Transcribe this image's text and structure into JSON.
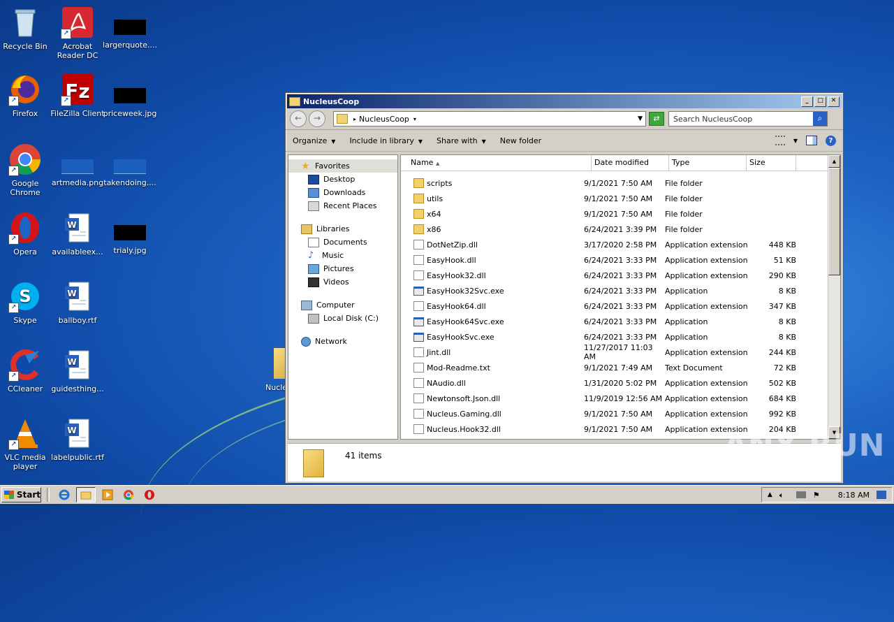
{
  "desktop": {
    "icons": [
      {
        "label": "Recycle Bin",
        "icon": "recycle-bin-icon"
      },
      {
        "label": "Acrobat Reader DC",
        "icon": "acrobat-icon"
      },
      {
        "label": "largerquote....",
        "icon": "image-thumbnail-icon"
      },
      {
        "label": "Firefox",
        "icon": "firefox-icon"
      },
      {
        "label": "FileZilla Client",
        "icon": "filezilla-icon"
      },
      {
        "label": "priceweek.jpg",
        "icon": "image-thumbnail-icon"
      },
      {
        "label": "Google Chrome",
        "icon": "chrome-icon"
      },
      {
        "label": "artmedia.png",
        "icon": "image-thumbnail-icon"
      },
      {
        "label": "takendoing....",
        "icon": "image-thumbnail-icon"
      },
      {
        "label": "Opera",
        "icon": "opera-icon"
      },
      {
        "label": "availableex...",
        "icon": "word-document-icon"
      },
      {
        "label": "trialy.jpg",
        "icon": "image-thumbnail-icon"
      },
      {
        "label": "Skype",
        "icon": "skype-icon"
      },
      {
        "label": "ballboy.rtf",
        "icon": "word-document-icon"
      },
      {
        "label": "CCleaner",
        "icon": "ccleaner-icon"
      },
      {
        "label": "guidesthing...",
        "icon": "word-document-icon"
      },
      {
        "label": "VLC media player",
        "icon": "vlc-icon"
      },
      {
        "label": "labelpublic.rtf",
        "icon": "word-document-icon"
      }
    ],
    "partial_icon_label": "Nucle"
  },
  "window": {
    "title": "NucleusCoop",
    "address": "NucleusCoop",
    "search_placeholder": "Search NucleusCoop",
    "toolbar": {
      "organize": "Organize",
      "include_in_library": "Include in library",
      "share_with": "Share with",
      "new_folder": "New folder"
    },
    "nav": {
      "favorites": "Favorites",
      "desktop": "Desktop",
      "downloads": "Downloads",
      "recent_places": "Recent Places",
      "libraries": "Libraries",
      "documents": "Documents",
      "music": "Music",
      "pictures": "Pictures",
      "videos": "Videos",
      "computer": "Computer",
      "local_disk": "Local Disk (C:)",
      "network": "Network"
    },
    "columns": {
      "name": "Name",
      "date": "Date modified",
      "type": "Type",
      "size": "Size"
    },
    "files": [
      {
        "name": "scripts",
        "date": "9/1/2021 7:50 AM",
        "type": "File folder",
        "size": "",
        "kind": "folder"
      },
      {
        "name": "utils",
        "date": "9/1/2021 7:50 AM",
        "type": "File folder",
        "size": "",
        "kind": "folder"
      },
      {
        "name": "x64",
        "date": "9/1/2021 7:50 AM",
        "type": "File folder",
        "size": "",
        "kind": "folder"
      },
      {
        "name": "x86",
        "date": "6/24/2021 3:39 PM",
        "type": "File folder",
        "size": "",
        "kind": "folder"
      },
      {
        "name": "DotNetZip.dll",
        "date": "3/17/2020 2:58 PM",
        "type": "Application extension",
        "size": "448 KB",
        "kind": "dll"
      },
      {
        "name": "EasyHook.dll",
        "date": "6/24/2021 3:33 PM",
        "type": "Application extension",
        "size": "51 KB",
        "kind": "dll"
      },
      {
        "name": "EasyHook32.dll",
        "date": "6/24/2021 3:33 PM",
        "type": "Application extension",
        "size": "290 KB",
        "kind": "dll"
      },
      {
        "name": "EasyHook32Svc.exe",
        "date": "6/24/2021 3:33 PM",
        "type": "Application",
        "size": "8 KB",
        "kind": "exe"
      },
      {
        "name": "EasyHook64.dll",
        "date": "6/24/2021 3:33 PM",
        "type": "Application extension",
        "size": "347 KB",
        "kind": "dll"
      },
      {
        "name": "EasyHook64Svc.exe",
        "date": "6/24/2021 3:33 PM",
        "type": "Application",
        "size": "8 KB",
        "kind": "exe"
      },
      {
        "name": "EasyHookSvc.exe",
        "date": "6/24/2021 3:33 PM",
        "type": "Application",
        "size": "8 KB",
        "kind": "exe"
      },
      {
        "name": "Jint.dll",
        "date": "11/27/2017 11:03 AM",
        "type": "Application extension",
        "size": "244 KB",
        "kind": "dll"
      },
      {
        "name": "Mod-Readme.txt",
        "date": "9/1/2021 7:49 AM",
        "type": "Text Document",
        "size": "72 KB",
        "kind": "txt"
      },
      {
        "name": "NAudio.dll",
        "date": "1/31/2020 5:02 PM",
        "type": "Application extension",
        "size": "502 KB",
        "kind": "dll"
      },
      {
        "name": "Newtonsoft.Json.dll",
        "date": "11/9/2019 12:56 AM",
        "type": "Application extension",
        "size": "684 KB",
        "kind": "dll"
      },
      {
        "name": "Nucleus.Gaming.dll",
        "date": "9/1/2021 7:50 AM",
        "type": "Application extension",
        "size": "992 KB",
        "kind": "dll"
      },
      {
        "name": "Nucleus.Hook32.dll",
        "date": "9/1/2021 7:50 AM",
        "type": "Application extension",
        "size": "204 KB",
        "kind": "dll"
      }
    ],
    "item_count": "41 items"
  },
  "taskbar": {
    "start_label": "Start",
    "clock": "8:18 AM"
  },
  "watermark": "ANY RUN"
}
